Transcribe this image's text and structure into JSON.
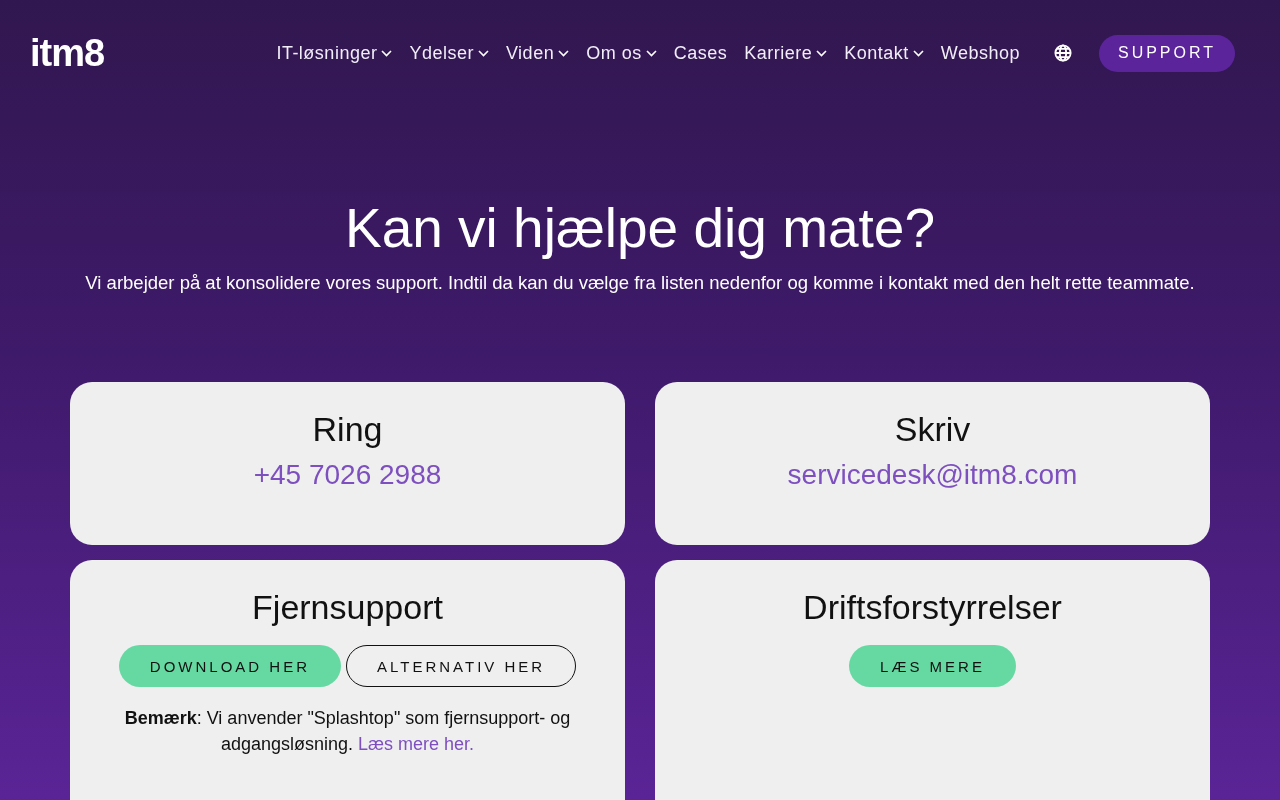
{
  "header": {
    "logo": "itm8",
    "nav": [
      {
        "label": "IT-løsninger",
        "has_dropdown": true
      },
      {
        "label": "Ydelser",
        "has_dropdown": true
      },
      {
        "label": "Viden",
        "has_dropdown": true
      },
      {
        "label": "Om os",
        "has_dropdown": true
      },
      {
        "label": "Cases",
        "has_dropdown": false
      },
      {
        "label": "Karriere",
        "has_dropdown": true
      },
      {
        "label": "Kontakt",
        "has_dropdown": true
      },
      {
        "label": "Webshop",
        "has_dropdown": false
      }
    ],
    "support_button": "SUPPORT"
  },
  "hero": {
    "title": "Kan vi hjælpe dig mate?",
    "subtitle": "Vi arbejder på at konsolidere vores support. Indtil da kan du vælge fra listen nedenfor og komme i kontakt med den helt rette teammate."
  },
  "cards": [
    {
      "kind": "contact",
      "title": "Ring",
      "link": "+45 7026 2988"
    },
    {
      "kind": "contact",
      "title": "Skriv",
      "link": "servicedesk@itm8.com"
    },
    {
      "kind": "actions",
      "title": "Fjernsupport",
      "buttons": [
        {
          "label": "DOWNLOAD HER",
          "kind": "filled"
        },
        {
          "label": "ALTERNATIV HER",
          "kind": "outline"
        }
      ],
      "note": "**Bemærk**: Vi anvender \"Splashtop\" som fjernsupport- og adgangsløsning.",
      "note_link": "Læs mere her."
    },
    {
      "kind": "actions",
      "title": "Driftsforstyrrelser",
      "buttons": [
        {
          "label": "LÆS MERE",
          "kind": "filled"
        }
      ]
    }
  ]
}
